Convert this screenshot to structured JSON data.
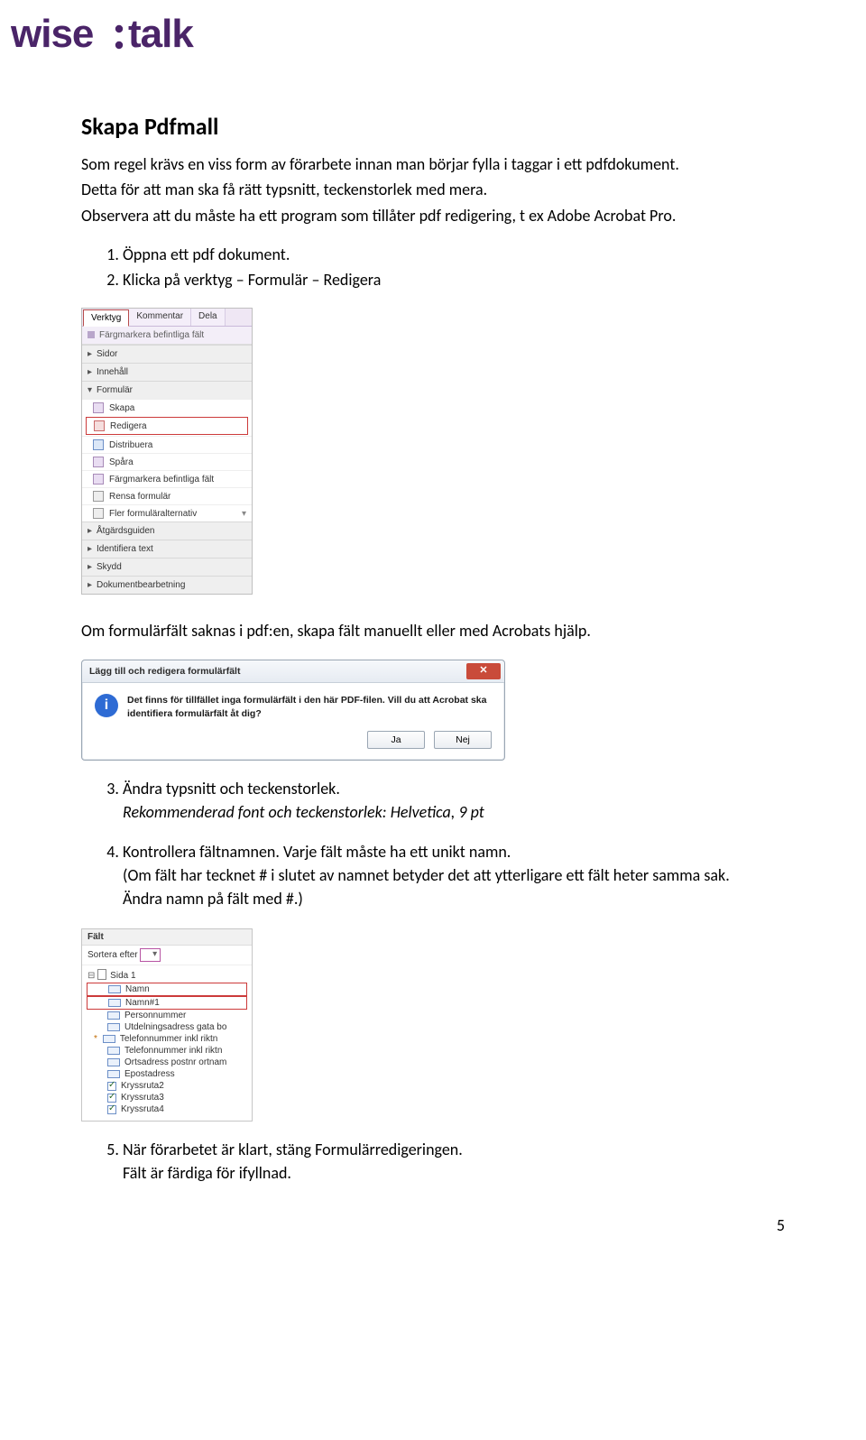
{
  "logo_text": "wise:talk",
  "title": "Skapa Pdfmall",
  "intro1": "Som regel krävs en viss form av förarbete innan man börjar fylla i taggar i ett pdfdokument.",
  "intro2": "Detta för att man ska få rätt typsnitt, teckenstorlek med mera.",
  "intro3": "Observera att du måste ha ett program som tillåter pdf redigering, t ex Adobe Acrobat Pro.",
  "step1": "Öppna ett pdf dokument.",
  "step2": "Klicka på verktyg – Formulär – Redigera",
  "mid": "Om formulärfält saknas i pdf:en, skapa fält manuellt eller med Acrobats hjälp.",
  "step3": "Ändra typsnitt och teckenstorlek.",
  "step3_sub": "Rekommenderad font och teckenstorlek: Helvetica, 9 pt",
  "step4a": "Kontrollera fältnamnen. Varje fält måste ha ett unikt namn.",
  "step4b": "(Om fält har tecknet # i slutet av namnet betyder det att ytterligare ett fält heter samma sak.",
  "step4c": "Ändra namn på fält med #.)",
  "step5a": "När förarbetet är klart, stäng Formulärredigeringen.",
  "step5b": "Fält är färdiga för ifyllnad.",
  "page_number": "5",
  "shot1": {
    "tabs": {
      "t1": "Verktyg",
      "t2": "Kommentar",
      "t3": "Dela"
    },
    "toolbar": "Färgmarkera befintliga fält",
    "acc": {
      "a1": "Sidor",
      "a2": "Innehåll",
      "a3": "Formulär"
    },
    "rows": {
      "r1": "Skapa",
      "r2": "Redigera",
      "r3": "Distribuera",
      "r4": "Spåra",
      "r5": "Färgmarkera befintliga fält",
      "r6": "Rensa formulär",
      "r7": "Fler formuläralternativ"
    },
    "acc2": {
      "b1": "Åtgärdsguiden",
      "b2": "Identifiera text",
      "b3": "Skydd",
      "b4": "Dokumentbearbetning"
    }
  },
  "shot2": {
    "title": "Lägg till och redigera formulärfält",
    "msg": "Det finns för tillfället inga formulärfält i den här PDF-filen. Vill du att Acrobat ska identifiera formulärfält åt dig?",
    "yes": "Ja",
    "no": "Nej"
  },
  "shot3": {
    "hdr": "Fält",
    "sort_label": "Sortera efter",
    "page": "Sida 1",
    "fields": {
      "f1": "Namn",
      "f2": "Namn#1",
      "f3": "Personnummer",
      "f4": "Utdelningsadress gata bo",
      "f5": "Telefonnummer inkl riktn",
      "f6": "Telefonnummer inkl riktn",
      "f7": "Ortsadress postnr ortnam",
      "f8": "Epostadress",
      "f9": "Kryssruta2",
      "f10": "Kryssruta3",
      "f11": "Kryssruta4"
    }
  }
}
